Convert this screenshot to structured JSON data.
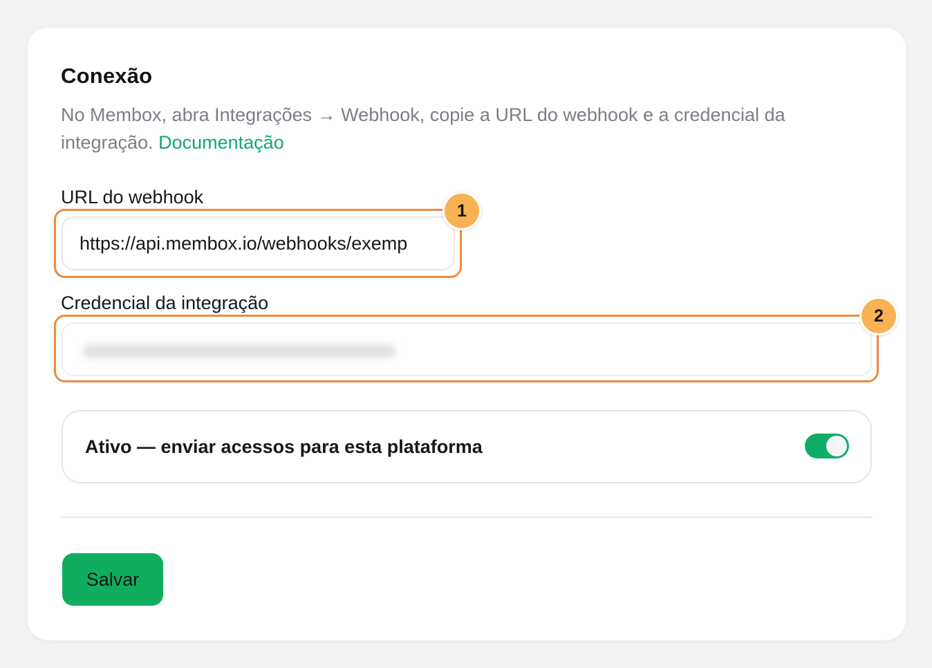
{
  "section": {
    "title": "Conexão",
    "description": "No Membox, abra Integrações → Webhook, copie a URL do webhook e a credencial da integração.",
    "doc_link": "Documentação"
  },
  "webhook": {
    "label": "URL do webhook",
    "value": "https://api.membox.io/webhooks/exemp",
    "marker": "1"
  },
  "credential": {
    "label": "Credencial da integração",
    "value_state": "blurred",
    "marker": "2"
  },
  "active": {
    "label": "Ativo — enviar acessos para esta plataforma",
    "enabled": true
  },
  "actions": {
    "save_label": "Salvar"
  },
  "colors": {
    "accent": "#10ad60",
    "link": "#14a869",
    "highlight": "#ef8a3c",
    "marker": "#f9b253"
  }
}
